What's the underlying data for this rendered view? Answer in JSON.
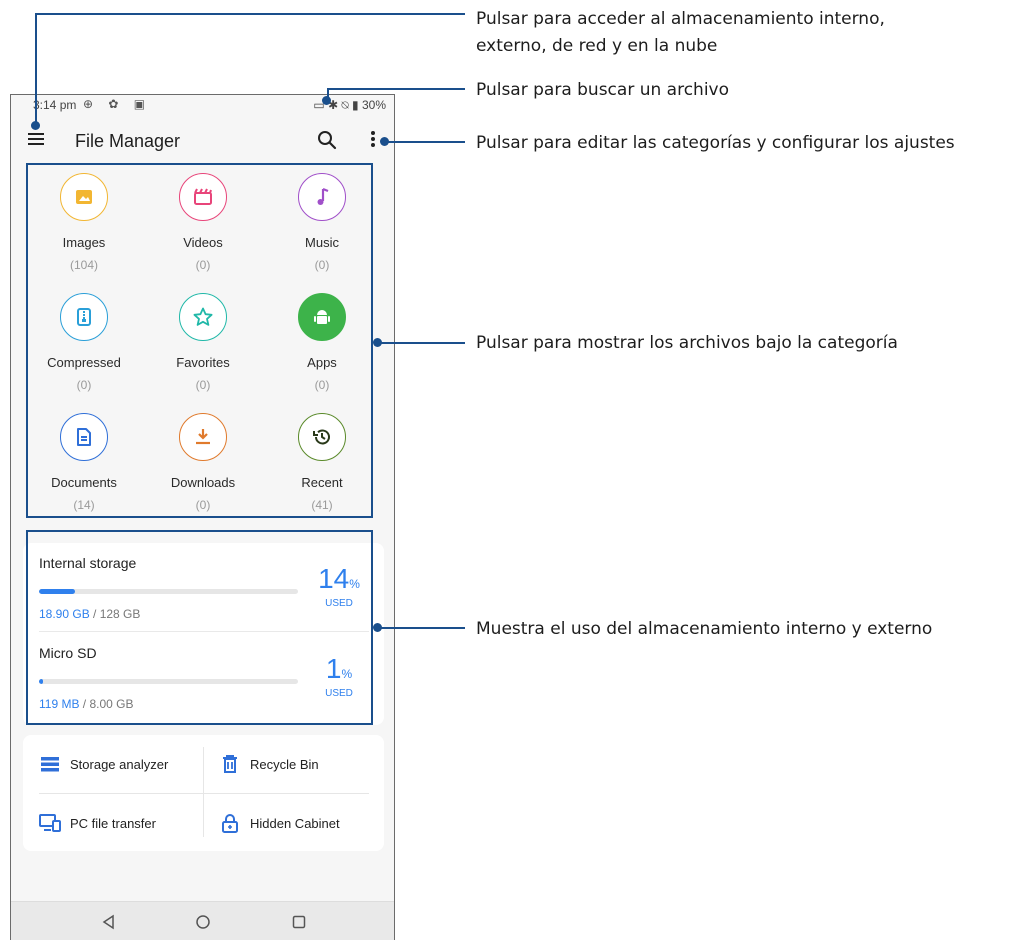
{
  "statusbar": {
    "time": "3:14 pm",
    "left_icons": "⊕ ✿ ▣",
    "right_icons": "▭ ✱ ⍉ ▮",
    "battery": "30%"
  },
  "appbar": {
    "title": "File Manager"
  },
  "categories": [
    {
      "label": "Images",
      "count": "(104)",
      "icon": "image-icon",
      "color": "#f2b632"
    },
    {
      "label": "Videos",
      "count": "(0)",
      "icon": "video-clapper-icon",
      "color": "#e8457a"
    },
    {
      "label": "Music",
      "count": "(0)",
      "icon": "music-note-icon",
      "color": "#a04fc9"
    },
    {
      "label": "Compressed",
      "count": "(0)",
      "icon": "zip-file-icon",
      "color": "#2a9fd8"
    },
    {
      "label": "Favorites",
      "count": "(0)",
      "icon": "star-icon",
      "color": "#20b8a8"
    },
    {
      "label": "Apps",
      "count": "(0)",
      "icon": "android-icon",
      "color": "#3db34a"
    },
    {
      "label": "Documents",
      "count": "(14)",
      "icon": "document-icon",
      "color": "#2f6fd8"
    },
    {
      "label": "Downloads",
      "count": "(0)",
      "icon": "download-icon",
      "color": "#e07a2c"
    },
    {
      "label": "Recent",
      "count": "(41)",
      "icon": "history-icon",
      "color": "#5a8a2a"
    }
  ],
  "storage": [
    {
      "name": "Internal storage",
      "used": "18.90 GB",
      "total": " / 128 GB",
      "percent": "14",
      "percent_sign": "%",
      "used_label": "USED",
      "fill": 0.14
    },
    {
      "name": "Micro SD",
      "used": "119 MB",
      "total": " / 8.00 GB",
      "percent": "1",
      "percent_sign": "%",
      "used_label": "USED",
      "fill": 0.01
    }
  ],
  "tools": {
    "storage_analyzer": "Storage analyzer",
    "recycle_bin": "Recycle Bin",
    "pc_file_transfer": "PC file transfer",
    "hidden_cabinet": "Hidden Cabinet"
  },
  "callouts": {
    "menu": "Pulsar para acceder al almacenamiento interno,\nexterno, de red y en la nube",
    "search": "Pulsar para buscar un archivo",
    "more": "Pulsar para editar las categorías y configurar los ajustes",
    "categories": "Pulsar para mostrar los archivos bajo la categoría",
    "storage": "Muestra el uso del almacenamiento interno y externo"
  },
  "colors": {
    "accent": "#2f80ed",
    "annotation": "#1a4f8c"
  }
}
